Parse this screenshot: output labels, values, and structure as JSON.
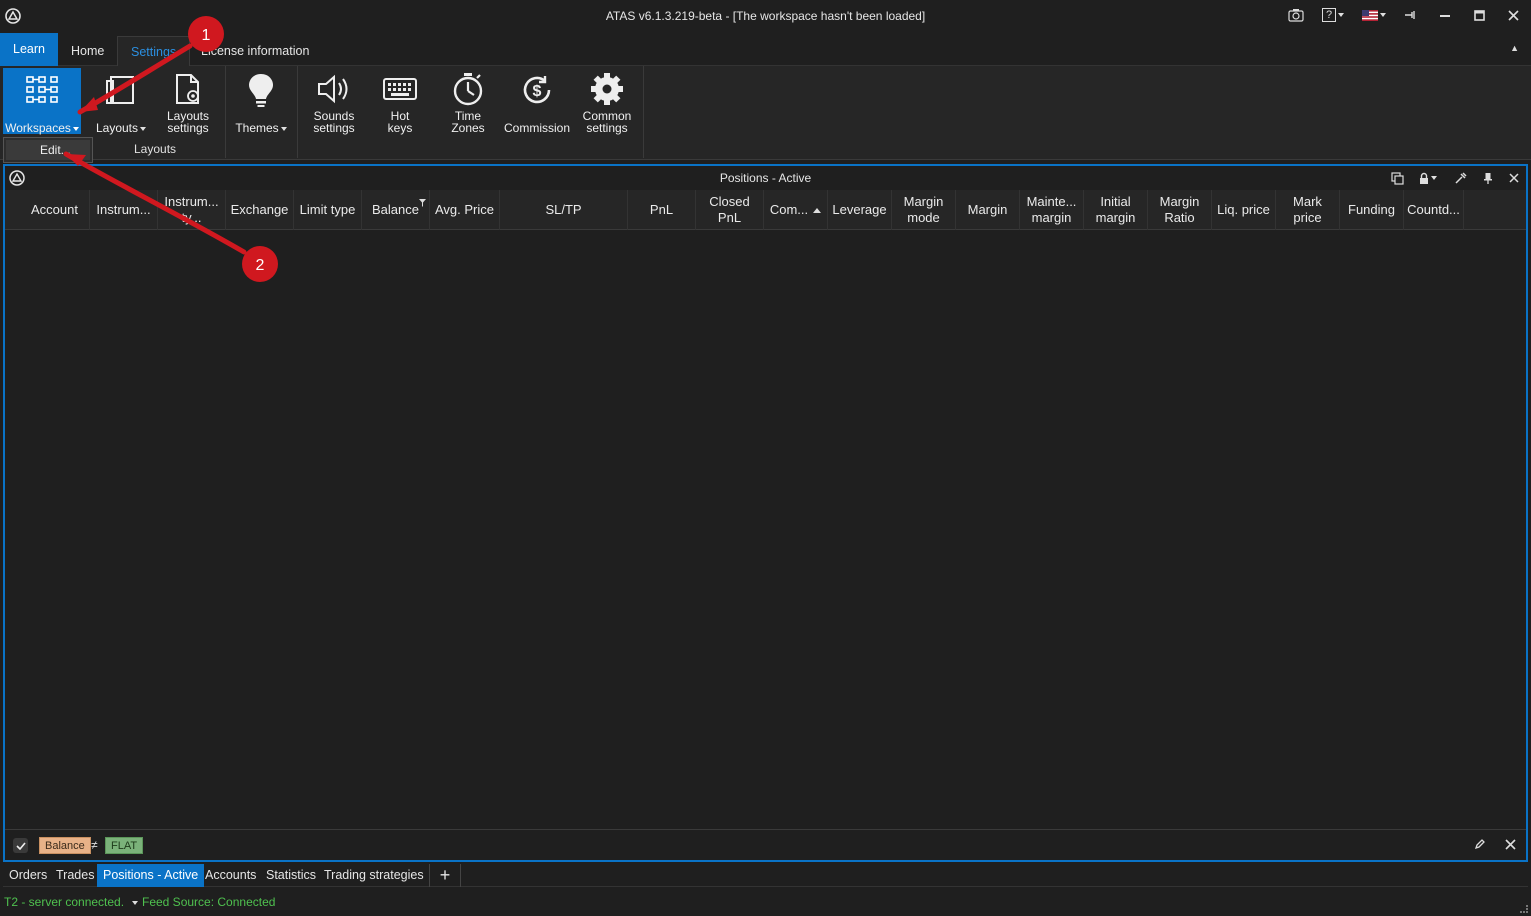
{
  "window": {
    "title": "ATAS v6.1.3.219-beta - [The workspace hasn't been loaded]",
    "controls": [
      "camera-icon",
      "help-icon",
      "flag-icon",
      "pin-icon",
      "minimize-icon",
      "maximize-icon",
      "close-icon"
    ],
    "help_label": "?"
  },
  "ribbon": {
    "tabs": [
      "Learn",
      "Home",
      "Settings",
      "License information"
    ],
    "active_tab": "Settings",
    "buttons": {
      "workspaces": "Workspaces",
      "layouts": "Layouts",
      "layouts_settings": "Layouts\nsettings",
      "themes": "Themes",
      "sounds": "Sounds\nsettings",
      "hotkeys": "Hot\nkeys",
      "timezones": "Time\nZones",
      "commission": "Commission",
      "common": "Common\nsettings"
    },
    "group_label": "Layouts",
    "dropdown": {
      "items": [
        "Edit..."
      ]
    }
  },
  "panel": {
    "title": "Positions - Active",
    "columns": [
      "Account",
      "Instrum...",
      "Instrum... ty...",
      "Exchange",
      "Limit type",
      "Balance",
      "Avg. Price",
      "SL/TP",
      "PnL",
      "Closed PnL",
      "Com...",
      "Leverage",
      "Margin mode",
      "Margin",
      "Mainte... margin",
      "Initial margin",
      "Margin Ratio",
      "Liq. price",
      "Mark price",
      "Funding",
      "Countd..."
    ],
    "rows": [],
    "filter": {
      "field": "Balance",
      "operator": "≠",
      "value": "FLAT"
    }
  },
  "bottom_tabs": {
    "items": [
      "Orders",
      "Trades",
      "Positions - Active",
      "Accounts",
      "Statistics",
      "Trading strategies"
    ],
    "active": "Positions - Active",
    "add_label": "+"
  },
  "status": {
    "server": "T2 - server connected.",
    "feed": "Feed Source: Connected"
  },
  "annotations": {
    "marker1": "1",
    "marker2": "2",
    "color": "#d0181f"
  },
  "colors": {
    "accent": "#0a73c7",
    "status_ok": "#4fc14f",
    "background": "#1f1f1f"
  }
}
